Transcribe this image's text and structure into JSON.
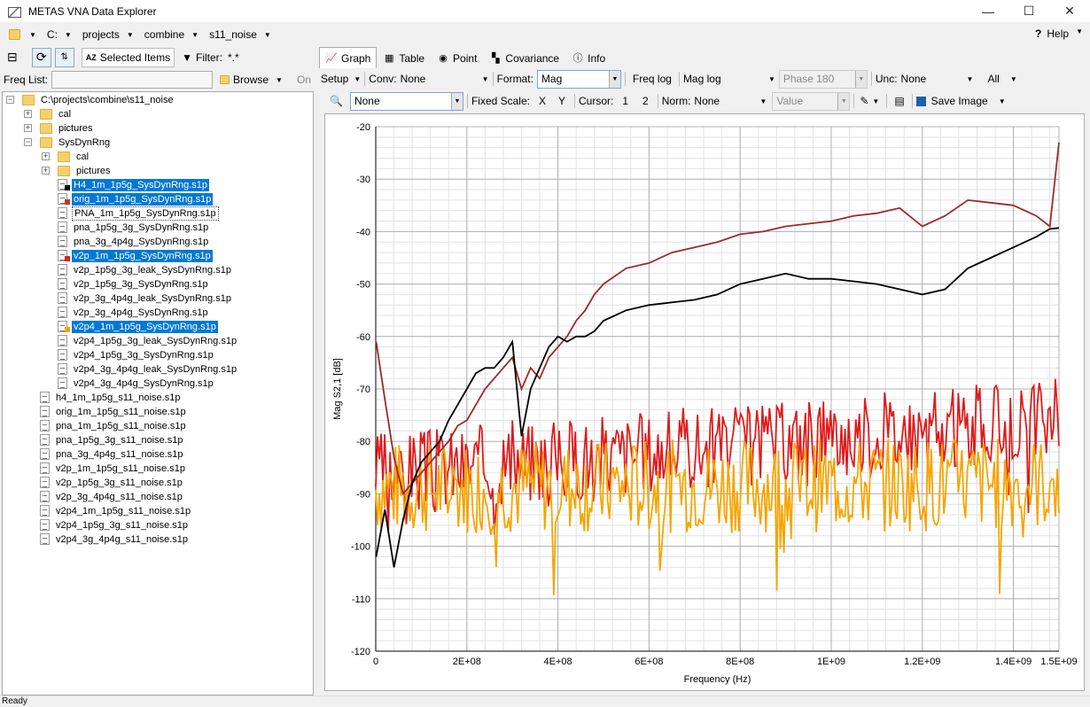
{
  "window": {
    "title": "METAS VNA Data Explorer",
    "minimize": "—",
    "maximize": "☐",
    "close": "✕"
  },
  "path": {
    "drive": "C:",
    "items": [
      "projects",
      "combine",
      "s11_noise"
    ]
  },
  "help": {
    "icon": "?",
    "label": "Help"
  },
  "left_toolbar": {
    "collapse": "⊟",
    "refresh": "⟳",
    "selected_items": "Selected Items",
    "filter_label": "Filter:",
    "filter_value": "*.*"
  },
  "freq": {
    "label": "Freq List:",
    "value": "",
    "browse": "Browse",
    "on": "On"
  },
  "tree": [
    {
      "label": "C:\\projects\\combine\\s11_noise",
      "type": "folder",
      "level": 0,
      "expander": "−"
    },
    {
      "label": "cal",
      "type": "folder",
      "level": 1,
      "expander": "+"
    },
    {
      "label": "pictures",
      "type": "folder",
      "level": 1,
      "expander": "+"
    },
    {
      "label": "SysDynRng",
      "type": "folder",
      "level": 1,
      "expander": "−"
    },
    {
      "label": "cal",
      "type": "folder",
      "level": 2,
      "expander": "+"
    },
    {
      "label": "pictures",
      "type": "folder",
      "level": 2,
      "expander": "+"
    },
    {
      "label": "H4_1m_1p5g_SysDynRng.s1p",
      "type": "file",
      "level": 2,
      "selected": true,
      "mark": "#000000"
    },
    {
      "label": "orig_1m_1p5g_SysDynRng.s1p",
      "type": "file",
      "level": 2,
      "selected": true,
      "mark": "#c0392b"
    },
    {
      "label": "PNA_1m_1p5g_SysDynRng.s1p",
      "type": "file",
      "level": 2,
      "focused": true
    },
    {
      "label": "pna_1p5g_3g_SysDynRng.s1p",
      "type": "file",
      "level": 2
    },
    {
      "label": "pna_3g_4p4g_SysDynRng.s1p",
      "type": "file",
      "level": 2
    },
    {
      "label": "v2p_1m_1p5g_SysDynRng.s1p",
      "type": "file",
      "level": 2,
      "selected": true,
      "mark": "#e02020"
    },
    {
      "label": "v2p_1p5g_3g_leak_SysDynRng.s1p",
      "type": "file",
      "level": 2
    },
    {
      "label": "v2p_1p5g_3g_SysDynRng.s1p",
      "type": "file",
      "level": 2
    },
    {
      "label": "v2p_3g_4p4g_leak_SysDynRng.s1p",
      "type": "file",
      "level": 2
    },
    {
      "label": "v2p_3g_4p4g_SysDynRng.s1p",
      "type": "file",
      "level": 2
    },
    {
      "label": "v2p4_1m_1p5g_SysDynRng.s1p",
      "type": "file",
      "level": 2,
      "selected": true,
      "mark": "#f5a500"
    },
    {
      "label": "v2p4_1p5g_3g_leak_SysDynRng.s1p",
      "type": "file",
      "level": 2
    },
    {
      "label": "v2p4_1p5g_3g_SysDynRng.s1p",
      "type": "file",
      "level": 2
    },
    {
      "label": "v2p4_3g_4p4g_leak_SysDynRng.s1p",
      "type": "file",
      "level": 2
    },
    {
      "label": "v2p4_3g_4p4g_SysDynRng.s1p",
      "type": "file",
      "level": 2
    },
    {
      "label": "h4_1m_1p5g_s11_noise.s1p",
      "type": "file",
      "level": 1
    },
    {
      "label": "orig_1m_1p5g_s11_noise.s1p",
      "type": "file",
      "level": 1
    },
    {
      "label": "pna_1m_1p5g_s11_noise.s1p",
      "type": "file",
      "level": 1
    },
    {
      "label": "pna_1p5g_3g_s11_noise.s1p",
      "type": "file",
      "level": 1
    },
    {
      "label": "pna_3g_4p4g_s11_noise.s1p",
      "type": "file",
      "level": 1
    },
    {
      "label": "v2p_1m_1p5g_s11_noise.s1p",
      "type": "file",
      "level": 1
    },
    {
      "label": "v2p_1p5g_3g_s11_noise.s1p",
      "type": "file",
      "level": 1
    },
    {
      "label": "v2p_3g_4p4g_s11_noise.s1p",
      "type": "file",
      "level": 1
    },
    {
      "label": "v2p4_1m_1p5g_s11_noise.s1p",
      "type": "file",
      "level": 1
    },
    {
      "label": "v2p4_1p5g_3g_s11_noise.s1p",
      "type": "file",
      "level": 1
    },
    {
      "label": "v2p4_3g_4p4g_s11_noise.s1p",
      "type": "file",
      "level": 1
    }
  ],
  "tabs": [
    {
      "label": "Graph",
      "icon": "graph-icon",
      "active": true
    },
    {
      "label": "Table",
      "icon": "table-icon"
    },
    {
      "label": "Point",
      "icon": "point-icon"
    },
    {
      "label": "Covariance",
      "icon": "covariance-icon"
    },
    {
      "label": "Info",
      "icon": "info-icon"
    }
  ],
  "toolbar1": {
    "setup": "Setup",
    "conv_label": "Conv:",
    "conv_value": "None",
    "format_label": "Format:",
    "format_value": "Mag",
    "freq_log": "Freq log",
    "mag_log": "Mag log",
    "phase": "Phase 180",
    "unc_label": "Unc:",
    "unc_value": "None",
    "all": "All"
  },
  "toolbar2": {
    "zoom_value": "None",
    "fixed_scale": "Fixed Scale:",
    "x": "X",
    "y": "Y",
    "cursor": "Cursor:",
    "c1": "1",
    "c2": "2",
    "norm": "Norm:",
    "norm_value": "None",
    "value": "Value",
    "save_image": "Save Image"
  },
  "chart_data": {
    "type": "line",
    "title": "",
    "xlabel": "Frequency (Hz)",
    "ylabel": "Mag S2,1 [dB]",
    "xlim": [
      0,
      1500000000
    ],
    "ylim": [
      -120,
      -20
    ],
    "xticks": [
      "0",
      "2E+08",
      "4E+08",
      "6E+08",
      "8E+08",
      "1E+09",
      "1.2E+09",
      "1.4E+09",
      "1.5E+09"
    ],
    "xtick_values": [
      0,
      200000000,
      400000000,
      600000000,
      800000000,
      1000000000,
      1200000000,
      1400000000,
      1500000000
    ],
    "yticks": [
      -20,
      -30,
      -40,
      -50,
      -60,
      -70,
      -80,
      -90,
      -100,
      -110,
      -120
    ],
    "grid": true,
    "series": [
      {
        "color": "#9b2b2b",
        "x": [
          1000000,
          20000000,
          40000000,
          60000000,
          80000000,
          100000000,
          120000000,
          140000000,
          160000000,
          180000000,
          200000000,
          220000000,
          240000000,
          260000000,
          280000000,
          300000000,
          320000000,
          340000000,
          360000000,
          380000000,
          400000000,
          420000000,
          440000000,
          460000000,
          480000000,
          500000000,
          550000000,
          600000000,
          650000000,
          700000000,
          750000000,
          800000000,
          850000000,
          900000000,
          950000000,
          1000000000,
          1050000000,
          1100000000,
          1150000000,
          1200000000,
          1250000000,
          1300000000,
          1350000000,
          1400000000,
          1450000000,
          1480000000,
          1500000000
        ],
        "y": [
          -61,
          -72,
          -83,
          -90,
          -88,
          -86,
          -84,
          -82,
          -80,
          -77,
          -76,
          -73,
          -70,
          -68,
          -66,
          -64,
          -70,
          -66,
          -68,
          -64,
          -62,
          -60,
          -57,
          -55,
          -52,
          -50,
          -47,
          -46,
          -44,
          -43,
          -42,
          -40.5,
          -40,
          -39,
          -38.5,
          -38,
          -37,
          -36.5,
          -35.5,
          -39,
          -37,
          -34,
          -34.5,
          -35,
          -37,
          -39,
          -23
        ]
      },
      {
        "color": "#000000",
        "x": [
          1000000,
          20000000,
          40000000,
          60000000,
          80000000,
          100000000,
          120000000,
          140000000,
          160000000,
          180000000,
          200000000,
          220000000,
          240000000,
          260000000,
          280000000,
          300000000,
          320000000,
          340000000,
          360000000,
          380000000,
          400000000,
          420000000,
          440000000,
          460000000,
          480000000,
          500000000,
          550000000,
          600000000,
          650000000,
          700000000,
          750000000,
          800000000,
          850000000,
          900000000,
          950000000,
          1000000000,
          1050000000,
          1100000000,
          1150000000,
          1200000000,
          1250000000,
          1300000000,
          1350000000,
          1400000000,
          1450000000,
          1480000000,
          1500000000
        ],
        "y": [
          -102,
          -93,
          -104,
          -95,
          -88,
          -84,
          -82,
          -80,
          -76,
          -73,
          -70,
          -67,
          -66,
          -66,
          -64,
          -61,
          -79,
          -70,
          -66,
          -62,
          -60,
          -61,
          -60,
          -60,
          -59,
          -57,
          -55,
          -54,
          -53.5,
          -53,
          -52,
          -50,
          -49,
          -48,
          -49,
          -49,
          -49.5,
          -50,
          -51,
          -52,
          -51,
          -47,
          -45,
          -43,
          -41,
          -39.5,
          -39.3
        ]
      },
      {
        "color": "#e01b1b",
        "noise": {
          "start": -86,
          "end": -76,
          "amp": 8,
          "seed": 3
        }
      },
      {
        "color": "#f5a500",
        "noise": {
          "start": -89,
          "end": -88,
          "amp": 9,
          "seed": 7
        }
      }
    ]
  },
  "status": {
    "text": "Ready"
  }
}
